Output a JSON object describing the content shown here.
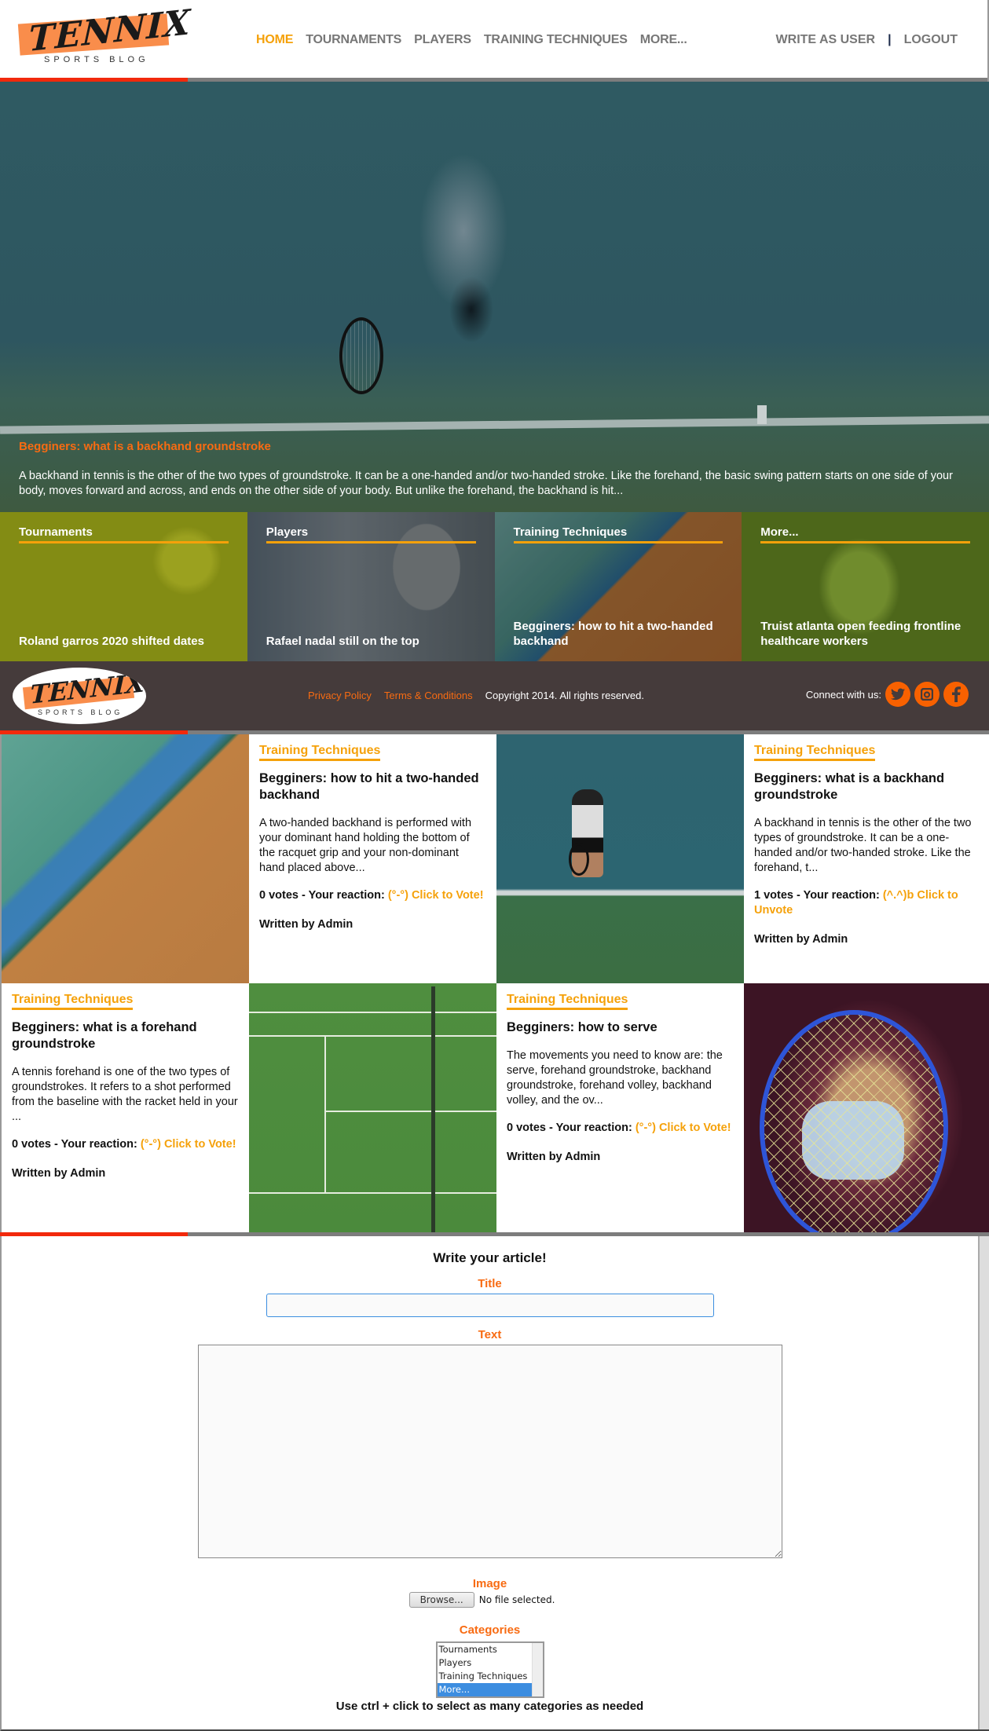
{
  "header": {
    "logo": {
      "word": "TENNIX",
      "tagline": "SPORTS BLOG"
    },
    "nav": [
      {
        "label": "HOME",
        "active": true
      },
      {
        "label": "TOURNAMENTS",
        "active": false
      },
      {
        "label": "PLAYERS",
        "active": false
      },
      {
        "label": "TRAINING TECHNIQUES",
        "active": false
      },
      {
        "label": "MORE...",
        "active": false
      }
    ],
    "user_links": {
      "write": "WRITE AS USER",
      "separator": "|",
      "logout": "LOGOUT"
    }
  },
  "scroll_progress": 0.19,
  "hero": {
    "title": "Begginers: what is a backhand groundstroke",
    "text": "A backhand in tennis is the other of the two types of groundstroke. It can be a one-handed and/or two-handed stroke. Like the forehand, the basic swing pattern starts on one side of your body, moves forward and across, and ends on the other side of your body. But unlike the forehand, the backhand is hit..."
  },
  "tiles": [
    {
      "category": "Tournaments",
      "headline": "Roland garros 2020 shifted dates",
      "image": "tennis-ball-on-clay"
    },
    {
      "category": "Players",
      "headline": "Rafael nadal still on the top",
      "image": "city-binoculars"
    },
    {
      "category": "Training Techniques",
      "headline": "Begginers: how to hit a two-handed backhand",
      "image": "aerial-tennis-courts"
    },
    {
      "category": "More...",
      "headline": "Truist atlanta open feeding frontline healthcare workers",
      "image": "lime-on-tree"
    }
  ],
  "footer": {
    "logo": {
      "word": "TENNIX",
      "tagline": "SPORTS BLOG"
    },
    "privacy": "Privacy Policy",
    "terms": "Terms & Conditions",
    "copyright": "Copyright 2014. All rights reserved.",
    "connect": "Connect with us:",
    "social": [
      {
        "name": "twitter",
        "glyph": "🐦"
      },
      {
        "name": "instagram",
        "glyph": "◙"
      },
      {
        "name": "facebook",
        "glyph": "f"
      }
    ]
  },
  "articles": [
    {
      "category": "Training Techniques",
      "title": "Begginers: how to hit a two-handed backhand",
      "excerpt": "A two-handed backhand is performed with your dominant hand holding the bottom of the racquet grip and your non-dominant hand placed above...",
      "votes_text": "0 votes - Your reaction: ",
      "vote_action": "(°-°) Click to Vote!",
      "author": "Written by Admin",
      "image": "aerial-tennis-courts"
    },
    {
      "category": "Training Techniques",
      "title": "Begginers: what is a backhand groundstroke",
      "excerpt": "A backhand in tennis is the other of the two types of groundstroke. It can be a one-handed and/or two-handed stroke. Like the forehand, t...",
      "votes_text": "1 votes - Your reaction: ",
      "vote_action": "(^.^)b Click to Unvote",
      "author": "Written by Admin",
      "image": "player-serving"
    },
    {
      "category": "Training Techniques",
      "title": "Begginers: what is a forehand groundstroke",
      "excerpt": "A tennis forehand is one of the two types of groundstrokes. It refers to a shot performed from the baseline with the racket held in your ...",
      "votes_text": "0 votes - Your reaction: ",
      "vote_action": "(°-°) Click to Vote!",
      "author": "Written by Admin",
      "image": "aerial-green-court"
    },
    {
      "category": "Training Techniques",
      "title": "Begginers: how to serve",
      "excerpt": "The movements you need to know are: the serve, forehand groundstroke, backhand groundstroke, forehand volley, backhand volley, and the ov...",
      "votes_text": "0 votes - Your reaction: ",
      "vote_action": "(°-°) Click to Vote!",
      "author": "Written by Admin",
      "image": "masked-person-racket"
    }
  ],
  "form": {
    "heading": "Write your article!",
    "title_label": "Title",
    "title_value": "",
    "text_label": "Text",
    "text_value": "",
    "image_label": "Image",
    "browse_label": "Browse...",
    "file_status": "No file selected.",
    "categories_label": "Categories",
    "category_options": [
      {
        "label": "Tournaments",
        "selected": false
      },
      {
        "label": "Players",
        "selected": false
      },
      {
        "label": "Training Techniques",
        "selected": false
      },
      {
        "label": "More...",
        "selected": true
      }
    ],
    "hint": "Use ctrl + click to select as many categories as needed"
  }
}
